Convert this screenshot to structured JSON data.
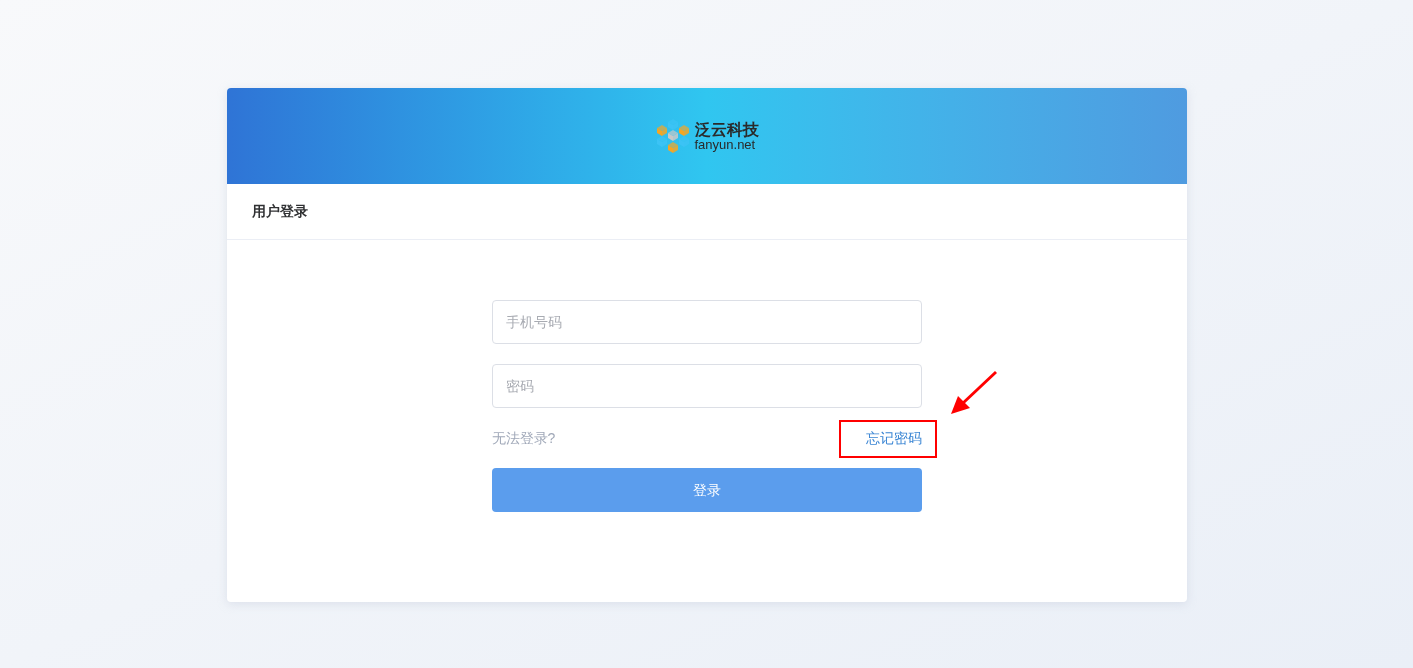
{
  "logo": {
    "name": "泛云科技",
    "domain": "fanyun.net"
  },
  "card_title": "用户登录",
  "fields": [
    {
      "placeholder": "手机号码"
    },
    {
      "placeholder": "密码"
    }
  ],
  "help_link": "无法登录?",
  "forgot_link": {
    "label": "忘记密码",
    "highlighted": true
  },
  "login_button": "登录"
}
